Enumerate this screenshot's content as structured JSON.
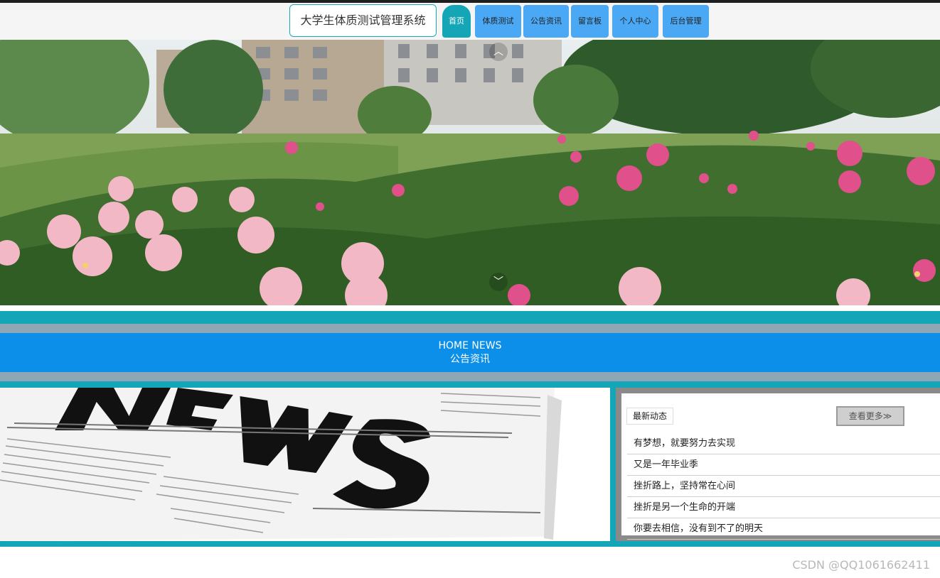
{
  "site": {
    "title": "大学生体质测试管理系统"
  },
  "nav": {
    "items": [
      {
        "label": "首页",
        "active": true
      },
      {
        "label": "体质测试"
      },
      {
        "label": "公告资讯"
      },
      {
        "label": "留言板"
      },
      {
        "label": "个人中心"
      },
      {
        "label": "后台管理"
      }
    ]
  },
  "banner": {
    "up_arrow": "︿",
    "down_arrow": "﹀",
    "up_icon": "chevron-up-icon",
    "down_icon": "chevron-down-icon"
  },
  "news_section": {
    "title_en": "HOME NEWS",
    "title_cn": "公告资讯"
  },
  "latest": {
    "tab_label": "最新动态",
    "more_label": "查看更多≫",
    "items": [
      "有梦想，就要努力去实现",
      "又是一年毕业季",
      "挫折路上，坚持常在心间",
      "挫折是另一个生命的开端",
      "你要去相信，没有到不了的明天"
    ]
  },
  "colors": {
    "accent": "#14a6b6",
    "nav_blue": "#4aa8f5",
    "news_blue": "#0b8fe8",
    "band_gray": "#8fa6b4"
  },
  "watermark": "CSDN @QQ1061662411"
}
